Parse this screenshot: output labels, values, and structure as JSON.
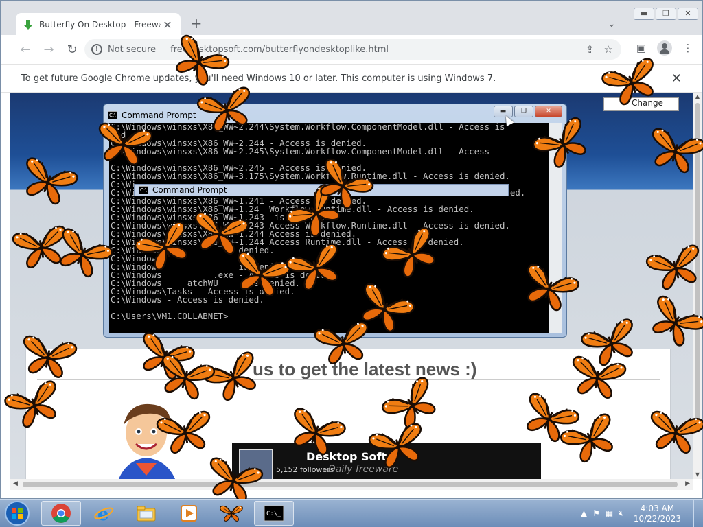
{
  "browser": {
    "tab_title": "Butterfly On Desktop - Freeware",
    "tab_close": "✕",
    "new_tab": "+",
    "tab_search": "⌄",
    "window_controls": [
      "▬",
      "❐",
      "✕"
    ],
    "nav": {
      "back": "←",
      "forward": "→",
      "reload": "↻"
    },
    "omnibox": {
      "security_label": "Not secure",
      "url": "freedesktopsoft.com/butterflyondesktoplike.html"
    },
    "icons": [
      "share-icon",
      "star-icon",
      "side-panel-icon",
      "profile-icon",
      "menu-icon"
    ],
    "infobar": {
      "text": "To get future Google Chrome updates, you'll need Windows 10 or later. This computer is using Windows 7.",
      "close": "✕"
    }
  },
  "page": {
    "search_placeholder": "Change",
    "news_heading": "us to get the latest news :)",
    "fb_card": {
      "title": "Desktop Soft",
      "subtitle": "5,152 followers",
      "watermark": "Daily freeware"
    }
  },
  "cmd": {
    "title": "Command Prompt",
    "inner_title": "Command Prompt",
    "lines": [
      "C:\\Windows\\winsxs\\X86_WW~2.244\\System.Workflow.ComponentModel.dll - Access is",
      "ied.",
      "C:\\Windows\\winsxs\\X86_WW~2.244 - Access is denied.",
      "C:\\Windows\\winsxs\\X86_WW~2.245\\System.Workflow.ComponentModel.dll - Access",
      "",
      "C:\\Windows\\winsxs\\X86_WW~2.245 - Access is denied.",
      "C:\\Windows\\winsxs\\X86_WW~3.175\\System.Workflow.Runtime.dll - Access is denied.",
      "C:\\Wi",
      "C:\\Wi                                                                  is denied.",
      "C:\\Windows\\winsxs\\X86_WW~1.241 - Access is denied.",
      "C:\\Windows\\winsxs\\X86_WW~1.24  Workflow.Runtime.dll - Access is denied.",
      "C:\\Windows\\winsxs\\X86_WW~1.243  is denied.",
      "C:\\Windows\\winsxs\\X86_WW~1.243 Access Workflow.Runtime.dll - Access is denied.",
      "C:\\Windows\\winsxs\\X86_WW~1.244 Access is denied.",
      "C:\\Windows\\winsxs\\X86_WW~1.244 Access Runtime.dll - Access is denied.",
      "C:\\Windows               denied.",
      "C:\\Windows",
      "C:\\Windows               is denied.",
      "C:\\Windows          .exe - Access is denied.",
      "C:\\Windows     atchWU      is denied.",
      "C:\\Windows\\Tasks - Access is denied.",
      "C:\\Windows - Access is denied.",
      "",
      "C:\\Users\\VM1.COLLABNET>"
    ],
    "controls": [
      "▬",
      "❐",
      "✕"
    ]
  },
  "taskbar": {
    "items": [
      "start-orb",
      "chrome",
      "internet-explorer",
      "explorer",
      "media-player",
      "butterfly-app",
      "command-prompt"
    ],
    "clock_time": "4:03 AM",
    "clock_date": "10/22/2023"
  },
  "colors": {
    "butterfly_orange": "#f07d12",
    "butterfly_black": "#1a0d05",
    "taskbar": "#6c8db8",
    "console_text": "#c0c0c0"
  }
}
